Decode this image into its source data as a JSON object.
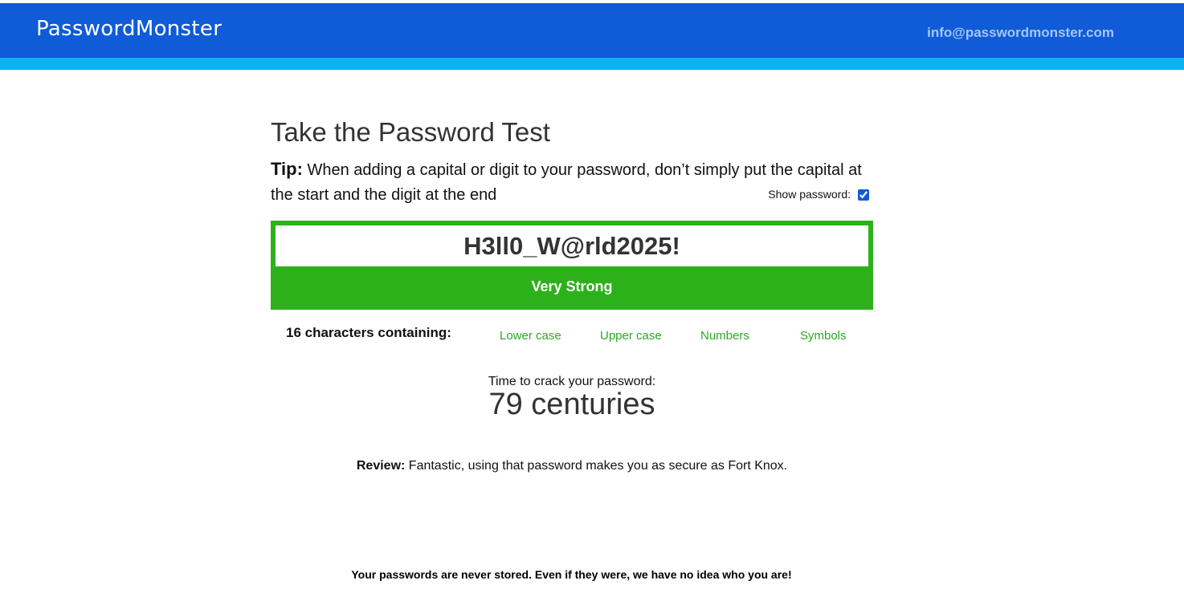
{
  "header": {
    "logo": "PasswordMonster",
    "email": "info@passwordmonster.com"
  },
  "main": {
    "title": "Take the Password Test",
    "tip_label": "Tip:",
    "tip_text": " When adding a capital or digit to your password, don’t simply put the capital at the start and the digit at the end",
    "show_password_label": "Show password:",
    "show_password_checked": true,
    "password_value": "H3ll0_W@rld2025!",
    "strength": "Very Strong",
    "strength_color": "#2db11b",
    "char_summary": "16 characters containing:",
    "criteria": [
      "Lower case",
      "Upper case",
      "Numbers",
      "Symbols"
    ],
    "criteria_color": "#2ea822",
    "crack_label": "Time to crack your password:",
    "crack_time": "79 centuries",
    "review_label": "Review:",
    "review_text": " Fantastic, using that password makes you as secure as Fort Knox."
  },
  "footer": {
    "note": "Your passwords are never stored. Even if they were, we have no idea who you are!"
  },
  "colors": {
    "header_blue": "#0f5bd8",
    "header_stripe": "#0cb4ef"
  }
}
